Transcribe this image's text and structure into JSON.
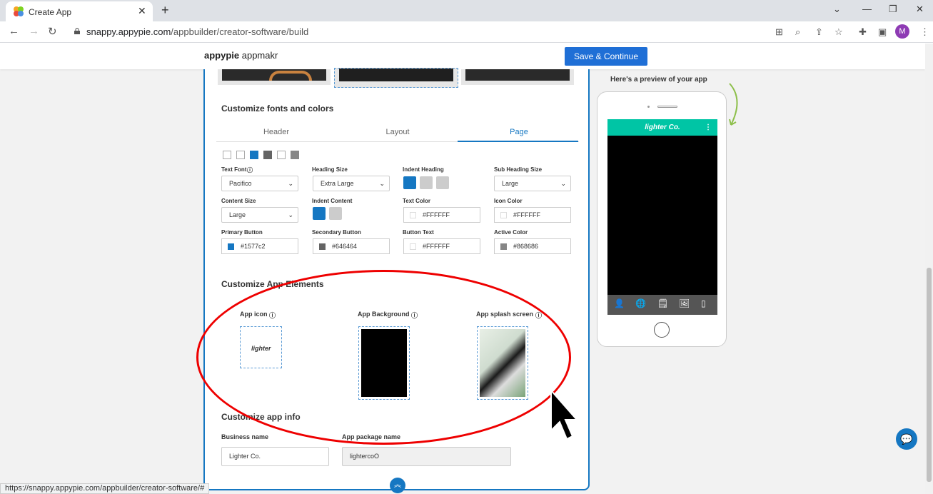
{
  "browser": {
    "tab_title": "Create App",
    "url_domain": "snappy.appypie.com",
    "url_path": "/appbuilder/creator-software/build",
    "avatar_letter": "M",
    "status_url": "https://snappy.appypie.com/appbuilder/creator-software/#"
  },
  "header": {
    "logo_bold": "appypie",
    "logo_light": " appmakr",
    "save_label": "Save & Continue"
  },
  "fonts": {
    "title": "Customize fonts and colors",
    "tabs": [
      "Header",
      "Layout",
      "Page"
    ],
    "active_tab": "Page",
    "text_font_label": "Text Font",
    "text_font": "Pacifico",
    "heading_size_label": "Heading Size",
    "heading_size": "Extra Large",
    "indent_heading_label": "Indent Heading",
    "sub_heading_label": "Sub Heading Size",
    "sub_heading": "Large",
    "content_size_label": "Content Size",
    "content_size": "Large",
    "indent_content_label": "Indent Content",
    "text_color_label": "Text Color",
    "text_color": "#FFFFFF",
    "icon_color_label": "Icon Color",
    "icon_color": "#FFFFFF",
    "primary_label": "Primary Button",
    "primary": "#1577c2",
    "secondary_label": "Secondary Button",
    "secondary": "#646464",
    "button_text_label": "Button Text",
    "button_text": "#FFFFFF",
    "active_color_label": "Active Color",
    "active_color": "#868686"
  },
  "elements": {
    "title": "Customize App Elements",
    "app_icon": "App icon",
    "app_background": "App Background",
    "splash": "App splash screen",
    "icon_text": "lighter"
  },
  "info": {
    "title": "Customize app info",
    "business_label": "Business name",
    "business": "Lighter Co.",
    "package_label": "App package name",
    "package": "lightercoO"
  },
  "preview": {
    "title": "Here's a preview of your app",
    "app_name": "lighter Co."
  }
}
